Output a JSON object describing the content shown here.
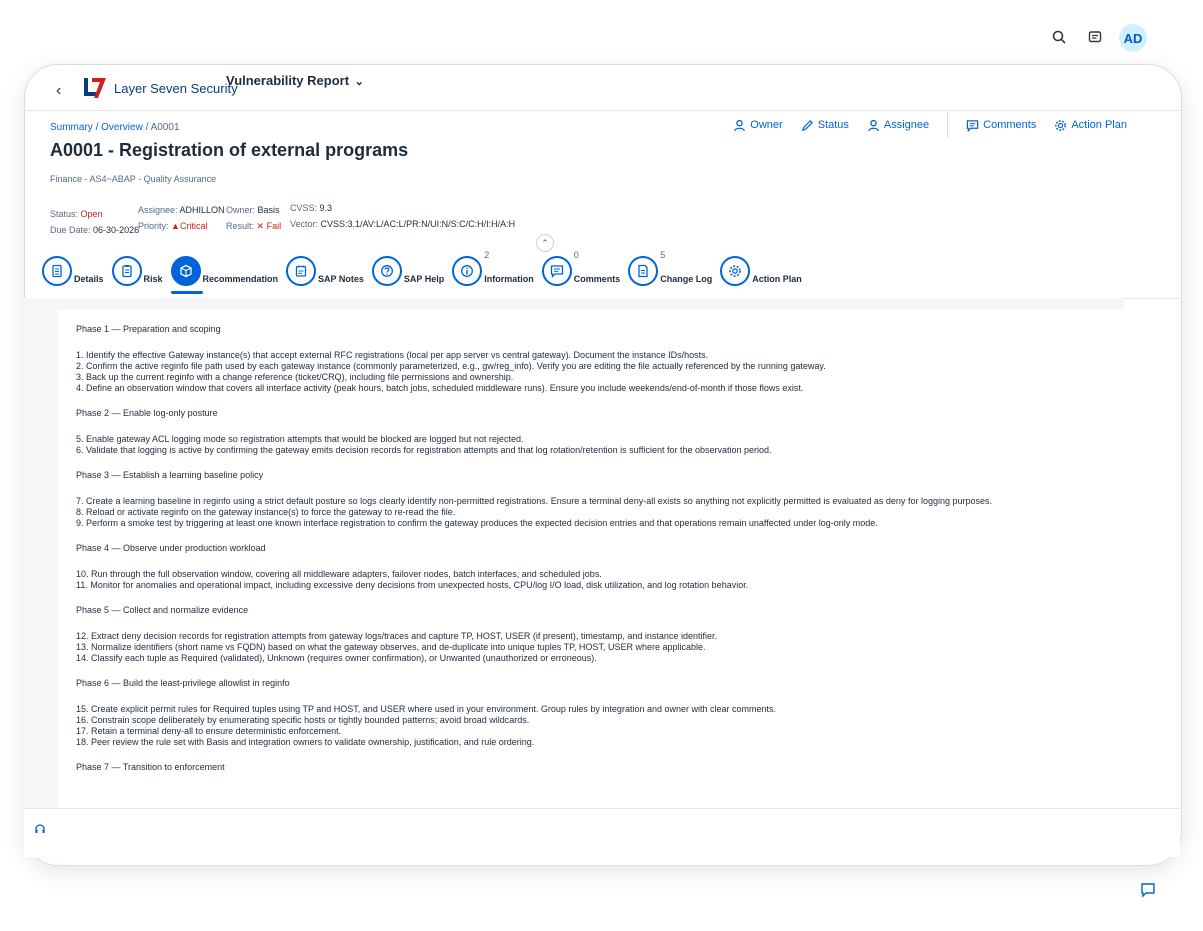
{
  "topbar": {
    "avatar": "AD"
  },
  "shell": {
    "brand": "Layer Seven Security",
    "app_title": "Vulnerability Report",
    "app_chevron": "⌄"
  },
  "breadcrumb": {
    "items": [
      "Summary",
      "Overview",
      "A0001"
    ]
  },
  "page": {
    "title": "A0001 - Registration of external programs",
    "subtitle": "Finance - AS4~ABAP - Quality Assurance"
  },
  "actions": {
    "owner": "Owner",
    "status": "Status",
    "assignee": "Assignee",
    "comments": "Comments",
    "action_plan": "Action Plan"
  },
  "meta": {
    "status_label": "Status:",
    "status_value": "Open",
    "due_label": "Due Date:",
    "due_value": "06-30-2026",
    "assignee_label": "Assignee:",
    "assignee_value": "ADHILLON",
    "priority_label": "Priority:",
    "priority_value": "Critical",
    "owner_label": "Owner:",
    "owner_value": "Basis",
    "result_label": "Result:",
    "result_value": "Fail",
    "cvss_label": "CVSS:",
    "cvss_value": "9.3",
    "vector_label": "Vector:",
    "vector_value": "CVSS:3.1/AV:L/AC:L/PR:N/UI:N/S:C/C:H/I:H/A:H"
  },
  "tabs": [
    {
      "label": "Details",
      "count": ""
    },
    {
      "label": "Risk",
      "count": ""
    },
    {
      "label": "Recommendation",
      "count": ""
    },
    {
      "label": "SAP Notes",
      "count": ""
    },
    {
      "label": "SAP Help",
      "count": ""
    },
    {
      "label": "Information",
      "count": "2"
    },
    {
      "label": "Comments",
      "count": "0"
    },
    {
      "label": "Change Log",
      "count": "5"
    },
    {
      "label": "Action Plan",
      "count": ""
    }
  ],
  "content": {
    "phase1": "Phase 1 — Preparation and scoping",
    "p1": [
      "1. Identify the effective Gateway instance(s) that accept external RFC registrations (local per app server vs central gateway). Document the instance IDs/hosts.",
      "2. Confirm the active reginfo file path used by each gateway instance (commonly parameterized, e.g., gw/reg_info). Verify you are editing the file actually referenced by the running gateway.",
      "3. Back up the current reginfo with a change reference (ticket/CRQ), including file permissions and ownership.",
      "4. Define an observation window that covers all interface activity (peak hours, batch jobs, scheduled middleware runs). Ensure you include weekends/end-of-month if those flows exist."
    ],
    "phase2": "Phase 2 — Enable log-only posture",
    "p2": [
      "5. Enable gateway ACL logging mode so registration attempts that would be blocked are logged but not rejected.",
      "6. Validate that logging is active by confirming the gateway emits decision records for registration attempts and that log rotation/retention is sufficient for the observation period."
    ],
    "phase3": "Phase 3 — Establish a learning baseline policy",
    "p3": [
      "7. Create a learning baseline in reginfo using a strict default posture so logs clearly identify non-permitted registrations. Ensure a terminal deny-all exists so anything not explicitly permitted is evaluated as deny for logging purposes.",
      "8. Reload or activate reginfo on the gateway instance(s) to force the gateway to re-read the file.",
      "9. Perform a smoke test by triggering at least one known interface registration to confirm the gateway produces the expected decision entries and that operations remain unaffected under log-only mode."
    ],
    "phase4": "Phase 4 — Observe under production workload",
    "p4": [
      "10. Run through the full observation window, covering all middleware adapters, failover nodes, batch interfaces, and scheduled jobs.",
      "11. Monitor for anomalies and operational impact, including excessive deny decisions from unexpected hosts, CPU/log I/O load, disk utilization, and log rotation behavior."
    ],
    "phase5": "Phase 5 — Collect and normalize evidence",
    "p5": [
      "12. Extract deny decision records for registration attempts from gateway logs/traces and capture TP, HOST, USER (if present), timestamp, and instance identifier.",
      "13. Normalize identifiers (short name vs FQDN) based on what the gateway observes, and de-duplicate into unique tuples TP, HOST, USER where applicable.",
      "14. Classify each tuple as Required (validated), Unknown (requires owner confirmation), or Unwanted (unauthorized or erroneous)."
    ],
    "phase6": "Phase 6 — Build the least-privilege allowlist in reginfo",
    "p6": [
      "15. Create explicit permit rules for Required tuples using TP and HOST, and USER where used in your environment. Group rules by integration and owner with clear comments.",
      "16. Constrain scope deliberately by enumerating specific hosts or tightly bounded patterns; avoid broad wildcards.",
      "17. Retain a terminal deny-all to ensure deterministic enforcement.",
      "18. Peer review the rule set with Basis and integration owners to validate ownership, justification, and rule ordering."
    ],
    "phase7": "Phase 7 — Transition to enforcement"
  },
  "colors": {
    "accent": "#0064d9",
    "critical": "#d21d1d",
    "text": "#1d2d3e"
  }
}
